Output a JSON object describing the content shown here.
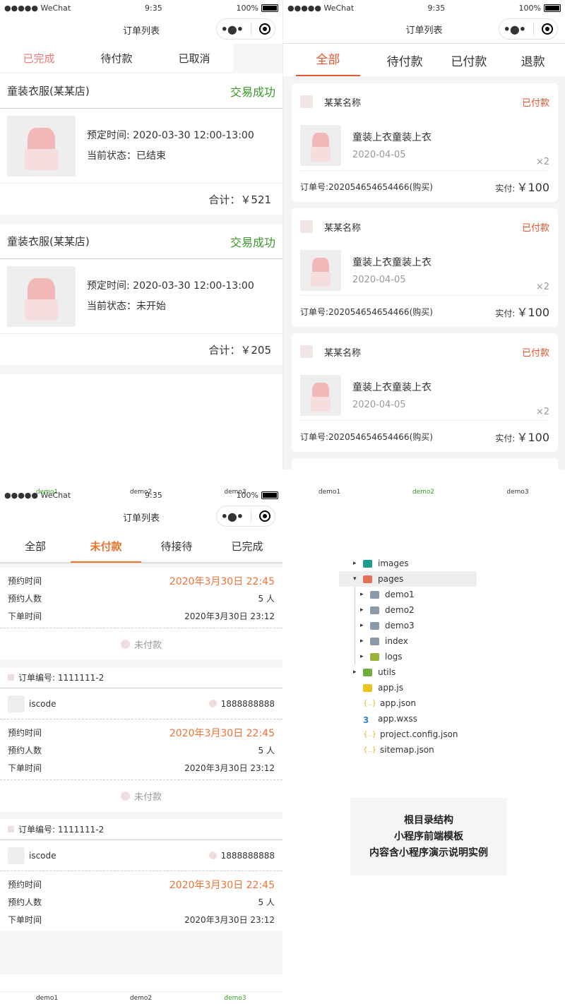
{
  "common": {
    "carrier": "●●●●● WeChat",
    "time": "9:35",
    "battery": "100%",
    "nav_title": "订单列表",
    "more_glyph": "•●•"
  },
  "p1": {
    "tabs": [
      "已完成",
      "待付款",
      "已取消"
    ],
    "orders": [
      {
        "shop": "童装衣服(某某店)",
        "status": "交易成功",
        "time_label": "预定时间: 2020-03-30 12:00-13:00",
        "state_label": "当前状态：已结束",
        "total": "合计：￥521"
      },
      {
        "shop": "童装衣服(某某店)",
        "status": "交易成功",
        "time_label": "预定时间: 2020-03-30 12:00-13:00",
        "state_label": "当前状态：未开始",
        "total": "合计：￥205"
      }
    ]
  },
  "p2": {
    "tabs": [
      "全部",
      "待付款",
      "已付款",
      "退款"
    ],
    "orders": [
      {
        "shop": "某某名称",
        "status": "已付款",
        "title": "童装上衣童装上衣",
        "date": "2020-04-05",
        "qty": "×2",
        "order_no": "订单号:202054654654466(购买)",
        "paid_label": "实付:",
        "paid": "￥100"
      },
      {
        "shop": "某某名称",
        "status": "已付款",
        "title": "童装上衣童装上衣",
        "date": "2020-04-05",
        "qty": "×2",
        "order_no": "订单号:202054654654466(购买)",
        "paid_label": "实付:",
        "paid": "￥100"
      },
      {
        "shop": "某某名称",
        "status": "已付款",
        "title": "童装上衣童装上衣",
        "date": "2020-04-05",
        "qty": "×2",
        "order_no": "订单号:202054654654466(购买)",
        "paid_label": "实付:",
        "paid": "￥100"
      }
    ]
  },
  "p3": {
    "tabs": [
      "全部",
      "未付款",
      "待接待",
      "已完成"
    ],
    "first": {
      "rows": [
        [
          "预约时间",
          "2020年3月30日 22:45"
        ],
        [
          "预约人数",
          "5 人"
        ],
        [
          "下单时间",
          "2020年3月30日 23:12"
        ]
      ],
      "status": "未付款"
    },
    "orders": [
      {
        "order_no": "订单编号: 1111111-2",
        "user": "iscode",
        "phone": "1888888888",
        "rows": [
          [
            "预约时间",
            "2020年3月30日 22:45"
          ],
          [
            "预约人数",
            "5 人"
          ],
          [
            "下单时间",
            "2020年3月30日 23:12"
          ]
        ],
        "status": "未付款"
      },
      {
        "order_no": "订单编号: 1111111-2",
        "user": "iscode",
        "phone": "1888888888",
        "rows": [
          [
            "预约时间",
            "2020年3月30日 22:45"
          ],
          [
            "预约人数",
            "5 人"
          ],
          [
            "下单时间",
            "2020年3月30日 23:12"
          ]
        ]
      }
    ]
  },
  "demo_tabs": {
    "row1_left": [
      "demo1",
      "demo2",
      "demo3"
    ],
    "row1_right": [
      "demo1",
      "demo2",
      "demo3"
    ],
    "row_bottom": [
      "demo1",
      "demo2",
      "demo3"
    ]
  },
  "tree": {
    "items": [
      {
        "name": "images",
        "indent": 0,
        "arrow": "▸",
        "kind": "folder-img",
        "color": "#1e9e8e"
      },
      {
        "name": "pages",
        "indent": 0,
        "arrow": "▾",
        "kind": "folder-pages",
        "color": "#e2735a",
        "selected": true
      },
      {
        "name": "demo1",
        "indent": 1,
        "arrow": "▸",
        "kind": "folder",
        "color": "#8a9aa8"
      },
      {
        "name": "demo2",
        "indent": 1,
        "arrow": "▸",
        "kind": "folder",
        "color": "#8a9aa8"
      },
      {
        "name": "demo3",
        "indent": 1,
        "arrow": "▸",
        "kind": "folder",
        "color": "#8a9aa8"
      },
      {
        "name": "index",
        "indent": 1,
        "arrow": "▸",
        "kind": "folder",
        "color": "#8a9aa8"
      },
      {
        "name": "logs",
        "indent": 1,
        "arrow": "▸",
        "kind": "folder-logs",
        "color": "#9bb53a"
      },
      {
        "name": "utils",
        "indent": 0,
        "arrow": "▸",
        "kind": "folder-utils",
        "color": "#6fae3a"
      },
      {
        "name": "app.js",
        "indent": 0,
        "arrow": "",
        "kind": "js",
        "color": "#e9c41a"
      },
      {
        "name": "app.json",
        "indent": 0,
        "arrow": "",
        "kind": "json",
        "color": "#e9b21a"
      },
      {
        "name": "app.wxss",
        "indent": 0,
        "arrow": "",
        "kind": "css",
        "color": "#2f86d6"
      },
      {
        "name": "project.config.json",
        "indent": 0,
        "arrow": "",
        "kind": "json",
        "color": "#e9b21a"
      },
      {
        "name": "sitemap.json",
        "indent": 0,
        "arrow": "",
        "kind": "json",
        "color": "#e9b21a"
      }
    ],
    "caption": [
      "根目录结构",
      "小程序前端模板",
      "内容含小程序演示说明实例"
    ]
  }
}
